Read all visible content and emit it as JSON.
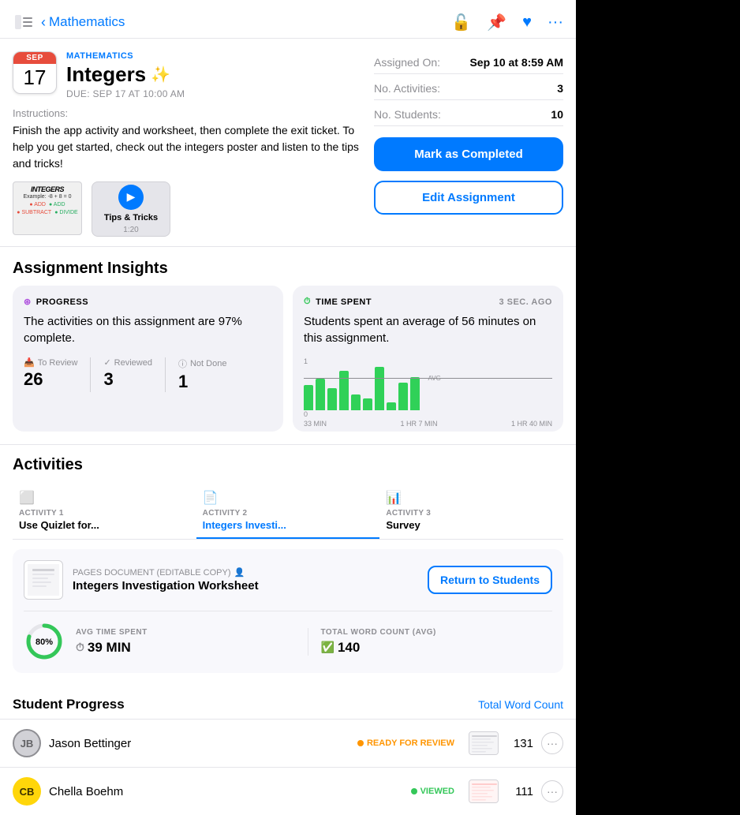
{
  "header": {
    "back_label": "Mathematics",
    "icons": [
      "lock-icon",
      "pin-icon",
      "heart-icon",
      "more-icon"
    ]
  },
  "assignment": {
    "month": "SEP",
    "day": "17",
    "subject": "MATHEMATICS",
    "title": "Integers",
    "sparkle": "✨",
    "due": "DUE: SEP 17 AT 10:00 AM",
    "instructions_label": "Instructions:",
    "instructions_text": "Finish the app activity and worksheet, then complete the exit ticket. To help you get started, check out the integers poster and listen to the tips and tricks!",
    "attachment1_title": "INTEGERS",
    "attachment2_title": "Tips & Tricks",
    "attachment2_duration": "1:20"
  },
  "assignment_meta": {
    "assigned_on_label": "Assigned On:",
    "assigned_on_value": "Sep 10 at 8:59 AM",
    "activities_label": "No. Activities:",
    "activities_value": "3",
    "students_label": "No. Students:",
    "students_value": "10",
    "mark_completed_label": "Mark as Completed",
    "edit_assignment_label": "Edit Assignment"
  },
  "insights": {
    "section_title": "Assignment Insights",
    "progress_card": {
      "header": "PROGRESS",
      "main_text": "The activities on this assignment are 97% complete.",
      "stats": [
        {
          "label": "To Review",
          "icon": "inbox-icon",
          "value": "26"
        },
        {
          "label": "Reviewed",
          "icon": "check-icon",
          "value": "3"
        },
        {
          "label": "Not Done",
          "icon": "info-icon",
          "value": "1"
        }
      ]
    },
    "time_card": {
      "header": "TIME SPENT",
      "time_ago": "3 sec. ago",
      "main_text": "Students spent an average of 56 minutes on this assignment.",
      "chart_labels": [
        "33 MIN",
        "1 HR 7 MIN",
        "1 HR 40 MIN"
      ],
      "y_labels": [
        "1",
        "0"
      ],
      "avg_label": "AVG"
    }
  },
  "activities": {
    "section_title": "Activities",
    "tabs": [
      {
        "label": "ACTIVITY 1",
        "name": "Use Quizlet for...",
        "icon": "quizlet-icon",
        "active": false
      },
      {
        "label": "ACTIVITY 2",
        "name": "Integers Investi...",
        "icon": "pages-icon",
        "active": true
      },
      {
        "label": "ACTIVITY 3",
        "name": "Survey",
        "icon": "survey-icon",
        "active": false
      }
    ],
    "current_activity": {
      "doc_type": "PAGES DOCUMENT (EDITABLE COPY)",
      "doc_name": "Integers Investigation Worksheet",
      "return_btn_label": "Return to Students",
      "completion_pct": 80,
      "avg_time_label": "AVG TIME SPENT",
      "avg_time_value": "39 MIN",
      "word_count_label": "TOTAL WORD COUNT (AVG)",
      "word_count_value": "140"
    }
  },
  "student_progress": {
    "title": "Student Progress",
    "sort_label": "Total Word Count",
    "students": [
      {
        "initials": "JB",
        "name": "Jason Bettinger",
        "status": "READY FOR REVIEW",
        "status_type": "review",
        "word_count": "131"
      },
      {
        "initials": "CB",
        "name": "Chella Boehm",
        "status": "VIEWED",
        "status_type": "viewed",
        "word_count": "111"
      }
    ]
  }
}
